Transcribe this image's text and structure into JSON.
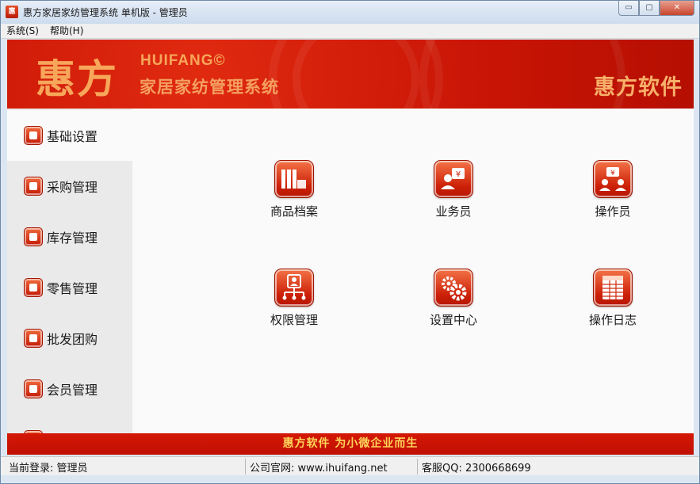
{
  "window": {
    "title": "惠方家居家纺管理系统 单机版 - 管理员",
    "icon": "app-logo-icon",
    "controls": {
      "minimize": "▭",
      "maximize": "▢",
      "close": "✕"
    }
  },
  "menubar": {
    "items": [
      {
        "label": "系统(S)"
      },
      {
        "label": "帮助(H)"
      }
    ]
  },
  "banner": {
    "logo_cn": "惠方",
    "logo_en": "HUIFANG©",
    "subtitle": "家居家纺管理系统",
    "brand": "惠方软件",
    "color": "#c81405",
    "accent": "#f7a65a"
  },
  "sidebar": {
    "items": [
      {
        "label": "基础设置",
        "icon": "basic-settings-icon",
        "active": true
      },
      {
        "label": "采购管理",
        "icon": "purchase-icon"
      },
      {
        "label": "库存管理",
        "icon": "inventory-icon"
      },
      {
        "label": "零售管理",
        "icon": "retail-icon"
      },
      {
        "label": "批发团购",
        "icon": "wholesale-icon"
      },
      {
        "label": "会员管理",
        "icon": "member-icon"
      },
      {
        "label": "",
        "icon": "more-icon"
      }
    ]
  },
  "main": {
    "buttons": [
      {
        "label": "商品档案",
        "icon": "product-archive-icon"
      },
      {
        "label": "业务员",
        "icon": "salesperson-icon"
      },
      {
        "label": "操作员",
        "icon": "operator-icon"
      },
      {
        "label": "权限管理",
        "icon": "permission-icon"
      },
      {
        "label": "设置中心",
        "icon": "settings-center-icon"
      },
      {
        "label": "操作日志",
        "icon": "operation-log-icon"
      }
    ]
  },
  "slogan": "惠方软件  为小微企业而生",
  "statusbar": {
    "login": "当前登录: 管理员",
    "website": "公司官网: www.ihuifang.net",
    "qq": "客服QQ: 2300668699"
  }
}
